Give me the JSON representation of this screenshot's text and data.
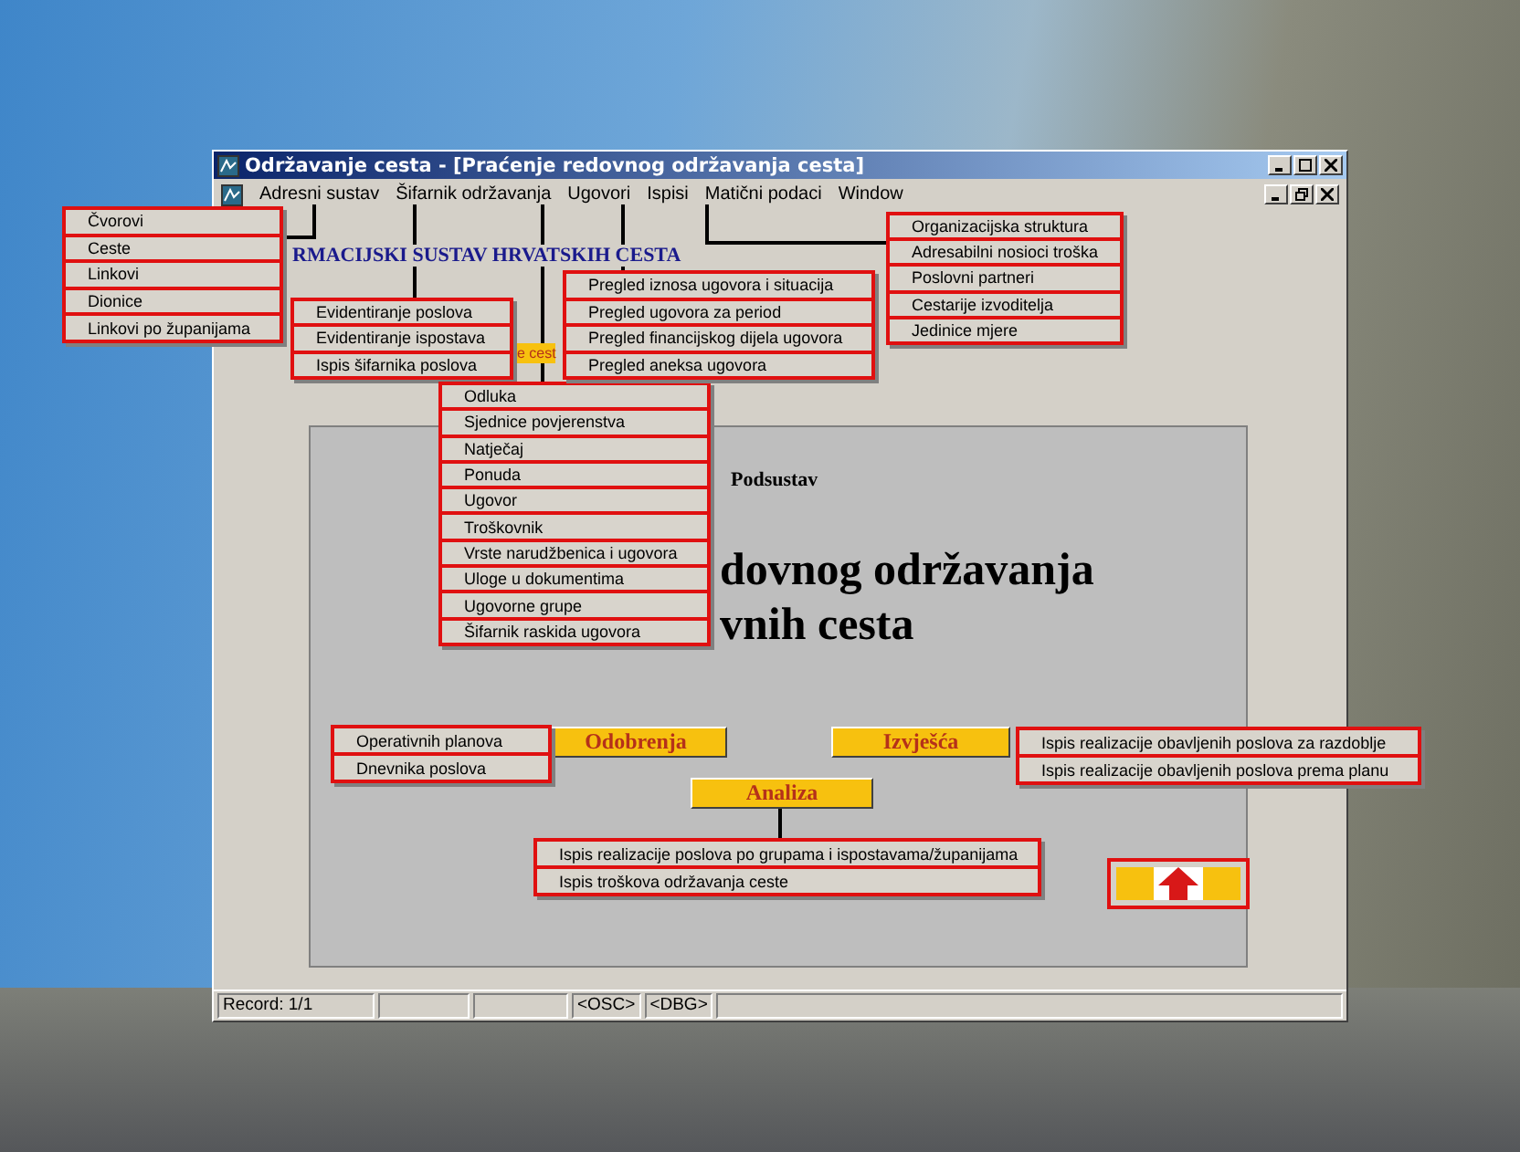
{
  "window": {
    "title": "Održavanje cesta - [Praćenje redovnog održavanja cesta]",
    "menu": [
      "Adresni sustav",
      "Šifarnik održavanja",
      "Ugovori",
      "Ispisi",
      "Matični podaci",
      "Window"
    ]
  },
  "form": {
    "banner": "RMACIJSKI SUSTAV HRVATSKIH CESTA",
    "hidden_button": "e cest",
    "subtitle": "Podsustav",
    "heading": [
      "dovnog održavanja",
      "vnih cesta"
    ],
    "buttons": [
      "Odobrenja",
      "Izvješća",
      "Analiza"
    ]
  },
  "menu_callouts": [
    {
      "items": [
        "Čvorovi",
        "Ceste",
        "Linkovi",
        "Dionice",
        "Linkovi po županijama"
      ]
    },
    {
      "items": [
        "Evidentiranje poslova",
        "Evidentiranje ispostava",
        "Ispis šifarnika poslova"
      ]
    },
    {
      "items": [
        "Odluka",
        "Sjednice povjerenstva",
        "Natječaj",
        "Ponuda",
        "Ugovor",
        "Troškovnik",
        "Vrste narudžbenica i ugovora",
        "Uloge u dokumentima",
        "Ugovorne grupe",
        "Šifarnik raskida ugovora"
      ]
    },
    {
      "items": [
        "Pregled iznosa ugovora i situacija",
        "Pregled ugovora za period",
        "Pregled financijskog dijela ugovora",
        "Pregled aneksa ugovora"
      ]
    },
    {
      "items": [
        "Organizacijska struktura",
        "Adresabilni nosioci troška",
        "Poslovni partneri",
        "Cestarije izvoditelja",
        "Jedinice mjere"
      ]
    }
  ],
  "button_callouts": [
    {
      "items": [
        "Operativnih planova",
        "Dnevnika poslova"
      ]
    },
    {
      "items": [
        "Ispis realizacije obavljenih poslova za razdoblje",
        "Ispis realizacije obavljenih poslova prema planu"
      ]
    },
    {
      "items": [
        "Ispis realizacije poslova po grupama i ispostavama/županijama",
        "Ispis troškova održavanja ceste"
      ]
    }
  ],
  "status_bar": {
    "record": "Record: 1/1",
    "panes": [
      "<OSC>",
      "<DBG>"
    ]
  }
}
